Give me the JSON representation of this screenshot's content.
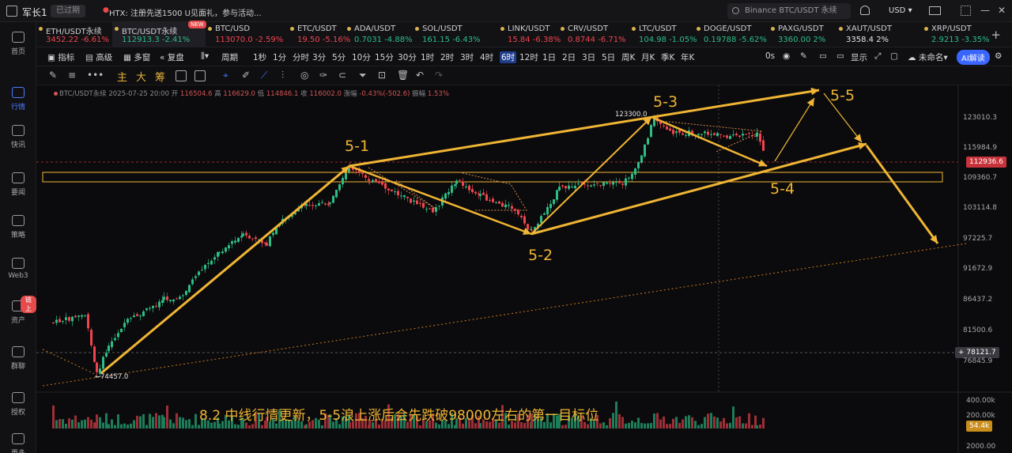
{
  "topbar": {
    "username": "军长1",
    "expired": "已过期",
    "notice": "HTX: 注册先送1500 U见面礼，参与活动...",
    "search_placeholder": "Binance BTC/USDT 永续",
    "currency": "USD",
    "currency_caret": "▾",
    "min_icon": "—",
    "max_icon": "☐",
    "close_icon": "✕"
  },
  "sidebar": {
    "items": [
      {
        "label": "首页",
        "icon": "home-icon"
      },
      {
        "label": "行情",
        "icon": "chart-icon"
      },
      {
        "label": "快讯",
        "icon": "news-icon"
      },
      {
        "label": "要闻",
        "icon": "article-icon"
      },
      {
        "label": "策略",
        "icon": "robot-icon"
      },
      {
        "label": "Web3",
        "icon": "web3-icon"
      },
      {
        "label": "资产",
        "icon": "wallet-icon",
        "badge": "链上"
      },
      {
        "label": "群聊",
        "icon": "chat-icon"
      },
      {
        "label": "授权",
        "icon": "key-icon"
      },
      {
        "label": "更多",
        "icon": "more-icon"
      }
    ]
  },
  "tickers": [
    {
      "name": "ETH/USDT永续",
      "price": "3452.22",
      "change": "-6.61%",
      "color": "red"
    },
    {
      "name": "BTC/USDT永续",
      "price": "112913.3",
      "change": "-2.41%",
      "color": "green",
      "active": true,
      "badge": "NEW"
    },
    {
      "name": "BTC/USD",
      "price": "113070.0",
      "change": "-2.59%",
      "color": "red"
    },
    {
      "name": "ETC/USDT",
      "price": "19.50",
      "change": "-5.16%",
      "color": "red"
    },
    {
      "name": "ADA/USDT",
      "price": "0.7031",
      "change": "-4.88%",
      "color": "green"
    },
    {
      "name": "SOL/USDT",
      "price": "161.15",
      "change": "-6.43%",
      "color": "green"
    },
    {
      "name": "LINK/USDT",
      "price": "15.84",
      "change": "-6.38%",
      "color": "red"
    },
    {
      "name": "CRV/USDT",
      "price": "0.8744",
      "change": "-6.71%",
      "color": "red"
    },
    {
      "name": "LTC/USDT",
      "price": "104.98",
      "change": "-1.05%",
      "color": "green"
    },
    {
      "name": "DOGE/USDT",
      "price": "0.19788",
      "change": "-5.62%",
      "color": "green"
    },
    {
      "name": "PAXG/USDT",
      "price": "3360.00",
      "change": "2%",
      "color": "green"
    },
    {
      "name": "XAUT/USDT",
      "price": "3358.4",
      "change": "2%",
      "color": "white"
    },
    {
      "name": "XRP/USDT",
      "price": "2.9213",
      "change": "-3.35%",
      "color": "green"
    }
  ],
  "toolbar1": {
    "indicators": "指标",
    "advanced": "高级",
    "multi": "多窗",
    "replay": "复盘",
    "period": "周期",
    "intervals": [
      "1秒",
      "1分",
      "分时",
      "3分",
      "5分",
      "10分",
      "15分",
      "30分",
      "1时",
      "2时",
      "3时",
      "4时",
      "6时",
      "12时",
      "1日",
      "2日",
      "3日",
      "5日",
      "周K",
      "月K",
      "季K",
      "年K"
    ],
    "selected_interval": "6时",
    "countdown": "0s",
    "display": "显示",
    "unnamed": "未命名",
    "ai": "AI解读"
  },
  "toolbar2": {
    "gold_labels": [
      "主",
      "大",
      "筹"
    ]
  },
  "chart": {
    "info": {
      "symbol": "BTC/USDT永续",
      "datetime": "2025-07-25 20:00",
      "open_label": "开",
      "open": "116504.6",
      "high_label": "高",
      "high": "116629.0",
      "low_label": "低",
      "low": "114846.1",
      "close_label": "收",
      "close": "116002.0",
      "change_label": "涨幅",
      "change": "-0.43%(-502.6)",
      "amp_label": "振幅",
      "amp": "1.53%"
    },
    "wave_labels": [
      "5-1",
      "5-2",
      "5-3",
      "5-4",
      "5-5"
    ],
    "high_annotation": "123300.0",
    "low_annotation": "74457.0",
    "caption": "8.2 中线行情更新，5-5浪上涨后会先跌破98000左右的第一目标位",
    "price_ticks": [
      "123010.3",
      "115984.9",
      "109360.7",
      "103114.8",
      "97225.7",
      "91672.9",
      "86437.2",
      "81500.6",
      "76845.9"
    ],
    "current_price": "112936.6",
    "cursor_price": "78121.7",
    "volume_ticks": [
      "400.00k",
      "200.00k",
      "2000.00"
    ],
    "volume_current": "54.4k",
    "colors": {
      "up": "#2dbd85",
      "down": "#f0444e",
      "wave": "#f0b534",
      "accent": "#3a66ff"
    }
  }
}
